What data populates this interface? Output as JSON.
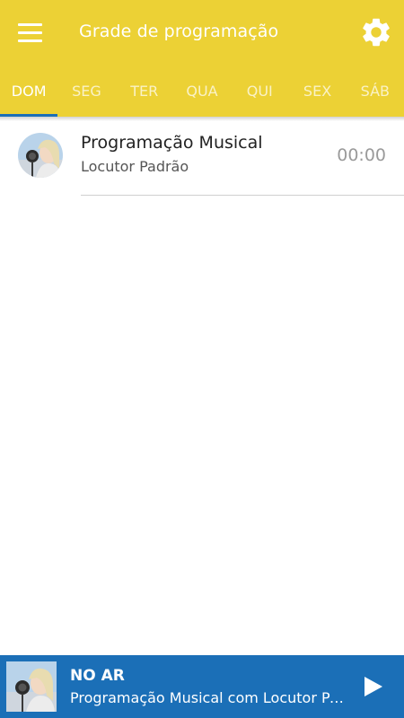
{
  "header": {
    "title": "Grade de programação",
    "menu_icon": "hamburger-menu-icon",
    "settings_icon": "gear-icon",
    "background_color": "#ecd135"
  },
  "days": {
    "active": "DOM",
    "tabs": [
      {
        "label": "DOM"
      },
      {
        "label": "SEG"
      },
      {
        "label": "TER"
      },
      {
        "label": "QUA"
      },
      {
        "label": "QUI"
      },
      {
        "label": "SEX"
      },
      {
        "label": "SÁB"
      }
    ],
    "indicator_color": "#1b6fb7"
  },
  "schedule": {
    "items": [
      {
        "title": "Programação Musical",
        "host": "Locutor Padrão",
        "time": "00:00",
        "avatar_icon": "host-avatar-photo"
      }
    ]
  },
  "player": {
    "label": "NO AR",
    "track": "Programação Musical com Locutor Padrão",
    "play_icon": "play-icon",
    "background_color": "#1b6fb7"
  }
}
